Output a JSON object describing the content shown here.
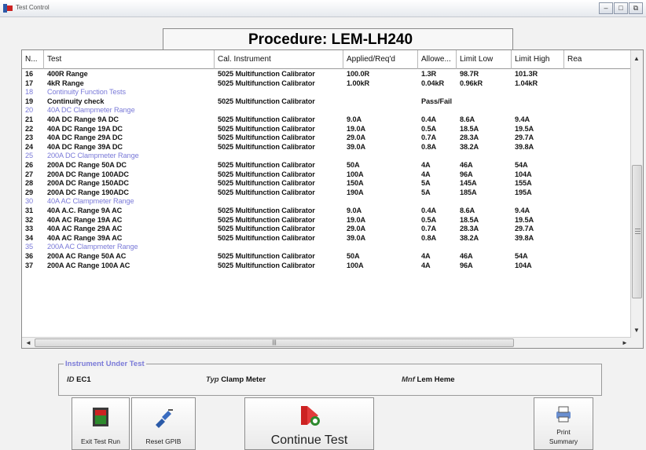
{
  "window": {
    "title": "Test Control",
    "min_glyph": "–",
    "max_glyph": "□",
    "restore_glyph": "⧉"
  },
  "procedure": {
    "label": "Procedure:",
    "name": "LEM-LH240"
  },
  "grid": {
    "columns": [
      "N...",
      "Test",
      "Cal. Instrument",
      "Applied/Req'd",
      "Allowe...",
      "Limit Low",
      "Limit High",
      "Rea"
    ],
    "rows": [
      {
        "n": "16",
        "test": "400R Range",
        "inst": "5025 Multifunction Calibrator",
        "applied": "100.0R",
        "allowed": "1.3R",
        "low": "98.7R",
        "high": "101.3R",
        "group": false
      },
      {
        "n": "17",
        "test": "4kR Range",
        "inst": "5025 Multifunction Calibrator",
        "applied": "1.00kR",
        "allowed": "0.04kR",
        "low": "0.96kR",
        "high": "1.04kR",
        "group": false
      },
      {
        "n": "18",
        "test": "Continuity Function Tests",
        "inst": "",
        "applied": "",
        "allowed": "",
        "low": "",
        "high": "",
        "group": true
      },
      {
        "n": "19",
        "test": "Continuity check",
        "inst": "5025 Multifunction Calibrator",
        "applied": "",
        "allowed": "Pass/Fail",
        "low": "",
        "high": "",
        "group": false
      },
      {
        "n": "20",
        "test": "40A DC Clampmeter Range",
        "inst": "",
        "applied": "",
        "allowed": "",
        "low": "",
        "high": "",
        "group": true
      },
      {
        "n": "21",
        "test": "40A DC Range 9A DC",
        "inst": "5025 Multifunction Calibrator",
        "applied": "9.0A",
        "allowed": "0.4A",
        "low": "8.6A",
        "high": "9.4A",
        "group": false
      },
      {
        "n": "22",
        "test": "40A DC Range 19A DC",
        "inst": "5025 Multifunction Calibrator",
        "applied": "19.0A",
        "allowed": "0.5A",
        "low": "18.5A",
        "high": "19.5A",
        "group": false
      },
      {
        "n": "23",
        "test": "40A DC Range 29A DC",
        "inst": "5025 Multifunction Calibrator",
        "applied": "29.0A",
        "allowed": "0.7A",
        "low": "28.3A",
        "high": "29.7A",
        "group": false
      },
      {
        "n": "24",
        "test": "40A DC Range 39A DC",
        "inst": "5025 Multifunction Calibrator",
        "applied": "39.0A",
        "allowed": "0.8A",
        "low": "38.2A",
        "high": "39.8A",
        "group": false
      },
      {
        "n": "25",
        "test": "200A DC Clampmeter Range",
        "inst": "",
        "applied": "",
        "allowed": "",
        "low": "",
        "high": "",
        "group": true
      },
      {
        "n": "26",
        "test": "200A DC Range 50A DC",
        "inst": "5025 Multifunction Calibrator",
        "applied": "50A",
        "allowed": "4A",
        "low": "46A",
        "high": "54A",
        "group": false
      },
      {
        "n": "27",
        "test": "200A DC Range 100ADC",
        "inst": "5025 Multifunction Calibrator",
        "applied": "100A",
        "allowed": "4A",
        "low": "96A",
        "high": "104A",
        "group": false
      },
      {
        "n": "28",
        "test": "200A DC Range 150ADC",
        "inst": "5025 Multifunction Calibrator",
        "applied": "150A",
        "allowed": "5A",
        "low": "145A",
        "high": "155A",
        "group": false
      },
      {
        "n": "29",
        "test": "200A DC Range 190ADC",
        "inst": "5025 Multifunction Calibrator",
        "applied": "190A",
        "allowed": "5A",
        "low": "185A",
        "high": "195A",
        "group": false
      },
      {
        "n": "30",
        "test": "40A AC Clampmeter Range",
        "inst": "",
        "applied": "",
        "allowed": "",
        "low": "",
        "high": "",
        "group": true
      },
      {
        "n": "31",
        "test": "40A A.C. Range 9A AC",
        "inst": "5025 Multifunction Calibrator",
        "applied": "9.0A",
        "allowed": "0.4A",
        "low": "8.6A",
        "high": "9.4A",
        "group": false
      },
      {
        "n": "32",
        "test": "40A AC Range 19A AC",
        "inst": "5025 Multifunction Calibrator",
        "applied": "19.0A",
        "allowed": "0.5A",
        "low": "18.5A",
        "high": "19.5A",
        "group": false
      },
      {
        "n": "33",
        "test": "40A AC Range 29A AC",
        "inst": "5025 Multifunction Calibrator",
        "applied": "29.0A",
        "allowed": "0.7A",
        "low": "28.3A",
        "high": "29.7A",
        "group": false
      },
      {
        "n": "34",
        "test": "40A AC Range 39A AC",
        "inst": "5025 Multifunction Calibrator",
        "applied": "39.0A",
        "allowed": "0.8A",
        "low": "38.2A",
        "high": "39.8A",
        "group": false
      },
      {
        "n": "35",
        "test": "200A AC Clampmeter Range",
        "inst": "",
        "applied": "",
        "allowed": "",
        "low": "",
        "high": "",
        "group": true
      },
      {
        "n": "36",
        "test": "200A AC Range 50A AC",
        "inst": "5025 Multifunction Calibrator",
        "applied": "50A",
        "allowed": "4A",
        "low": "46A",
        "high": "54A",
        "group": false
      },
      {
        "n": "37",
        "test": "200A AC Range 100A AC",
        "inst": "5025 Multifunction Calibrator",
        "applied": "100A",
        "allowed": "4A",
        "low": "96A",
        "high": "104A",
        "group": false
      }
    ]
  },
  "scroll": {
    "up": "▲",
    "down": "▼",
    "left": "◄",
    "right": "►",
    "grip": "|||"
  },
  "iut": {
    "legend": "Instrument Under Test",
    "id_label": "ID",
    "id_value": "EC1",
    "typ_label": "Typ",
    "typ_value": "Clamp Meter",
    "mnf_label": "Mnf",
    "mnf_value": "Lem Heme"
  },
  "buttons": {
    "exit": "Exit Test Run",
    "reset": "Reset GPIB",
    "continue": "Continue Test",
    "print_line1": "Print",
    "print_line2": "Summary"
  },
  "colors": {
    "group_text": "#7a7ad8",
    "accent_red": "#cc2222",
    "accent_green": "#2d8a2d",
    "accent_blue": "#2a5aa8"
  }
}
